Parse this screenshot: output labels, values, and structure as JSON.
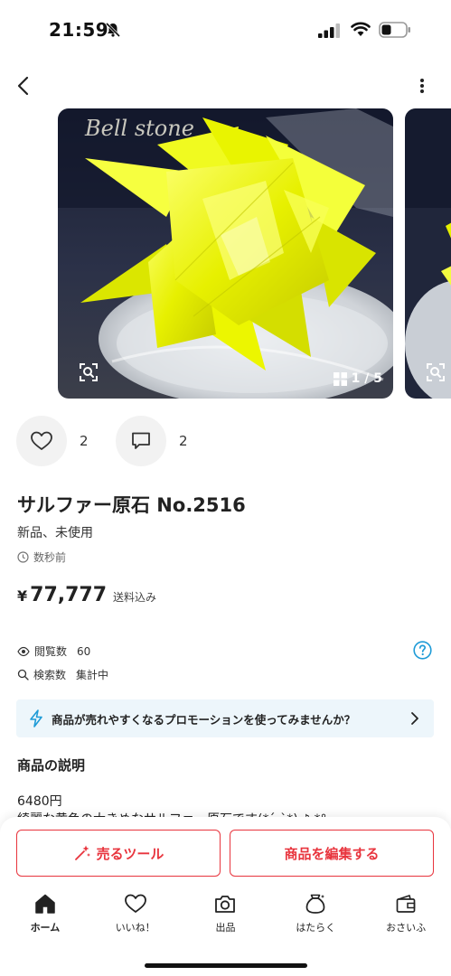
{
  "status_bar": {
    "time": "21:59"
  },
  "product": {
    "title": "サルファー原石 No.2516",
    "condition": "新品、未使用",
    "posted": "数秒前",
    "price_symbol": "¥",
    "price": "77,777",
    "shipping_note": "送料込み",
    "photo_watermark": "Bell stone",
    "photo_counter": "1 / 5"
  },
  "actions": {
    "like_count": "2",
    "comment_count": "2"
  },
  "stats": {
    "views_label": "閲覧数",
    "views_value": "60",
    "search_label": "検索数",
    "search_value": "集計中"
  },
  "promo": {
    "text": "商品が売れやすくなるプロモーションを使ってみませんか？"
  },
  "description": {
    "heading": "商品の説明",
    "line1": "6480円",
    "line2": "綺麗な黄色の大きめなサルファー原石です(*ˊᵕˋ*)   ♪.*°"
  },
  "bottom_actions": {
    "sell_tool_label": "売るツール",
    "edit_label": "商品を編集する"
  },
  "tab_bar": {
    "items": [
      {
        "label": "ホーム",
        "icon": "home-icon"
      },
      {
        "label": "いいね！",
        "icon": "heart-icon"
      },
      {
        "label": "出品",
        "icon": "camera-icon"
      },
      {
        "label": "はたらく",
        "icon": "money-bag-icon"
      },
      {
        "label": "おさいふ",
        "icon": "wallet-icon"
      }
    ]
  },
  "colors": {
    "accent": "#e8343d",
    "info": "#1e9bd7",
    "crystal": "#e8f000"
  }
}
